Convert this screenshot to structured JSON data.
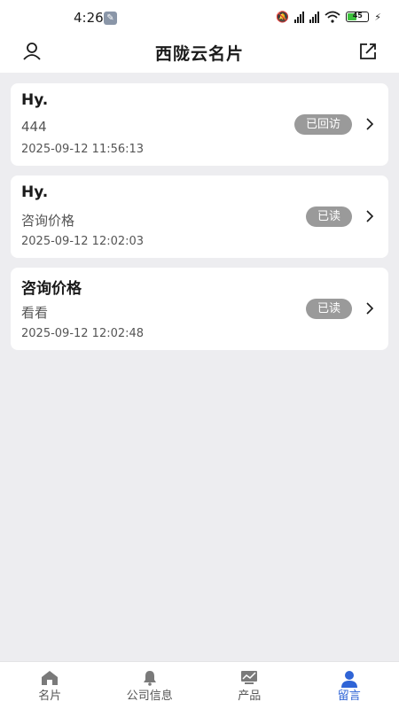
{
  "status_bar": {
    "time": "4:26",
    "battery_level": "45"
  },
  "header": {
    "title": "西陇云名片"
  },
  "messages": [
    {
      "title": "Hy.",
      "content": "444",
      "time": "2025-09-12 11:56:13",
      "status": "已回访"
    },
    {
      "title": "Hy.",
      "content": "咨询价格",
      "time": "2025-09-12 12:02:03",
      "status": "已读"
    },
    {
      "title": "咨询价格",
      "content": "看看",
      "time": "2025-09-12 12:02:48",
      "status": "已读"
    }
  ],
  "tabs": [
    {
      "label": "名片",
      "icon": "home-icon",
      "active": false
    },
    {
      "label": "公司信息",
      "icon": "bell-icon",
      "active": false
    },
    {
      "label": "产品",
      "icon": "chart-icon",
      "active": false
    },
    {
      "label": "留言",
      "icon": "person-icon",
      "active": true
    }
  ],
  "colors": {
    "accent": "#2f64d6",
    "badge": "#9a9a9a",
    "background": "#ededf0"
  }
}
